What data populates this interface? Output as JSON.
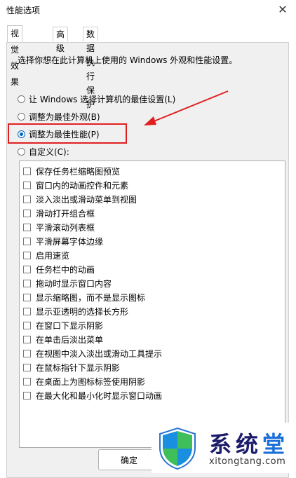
{
  "window": {
    "title": "性能选项",
    "close_symbol": "✕"
  },
  "tabs": [
    {
      "label": "视觉效果",
      "active": true
    },
    {
      "label": "高级",
      "active": false
    },
    {
      "label": "数据执行保护",
      "active": false
    }
  ],
  "description": "选择你想在此计算机上使用的 Windows 外观和性能设置。",
  "radios": [
    {
      "label": "让 Windows 选择计算机的最佳设置(L)",
      "checked": false
    },
    {
      "label": "调整为最佳外观(B)",
      "checked": false
    },
    {
      "label": "调整为最佳性能(P)",
      "checked": true
    },
    {
      "label": "自定义(C):",
      "checked": false
    }
  ],
  "effects": [
    "保存任务栏缩略图预览",
    "窗口内的动画控件和元素",
    "淡入淡出或滑动菜单到视图",
    "滑动打开组合框",
    "平滑滚动列表框",
    "平滑屏幕字体边缘",
    "启用速览",
    "任务栏中的动画",
    "拖动时显示窗口内容",
    "显示缩略图，而不是显示图标",
    "显示亚透明的选择长方形",
    "在窗口下显示阴影",
    "在单击后淡出菜单",
    "在视图中淡入淡出或滑动工具提示",
    "在鼠标指针下显示阴影",
    "在桌面上为图标标签使用阴影",
    "在最大化和最小化时显示窗口动画"
  ],
  "buttons": {
    "ok": "确定"
  },
  "watermark": {
    "title_main": "系统",
    "title_accent": "堂",
    "url": "xitongtang.com"
  },
  "colors": {
    "accent": "#0067c0",
    "highlight": "#e02020",
    "panel_bg": "#f0f0f0"
  }
}
